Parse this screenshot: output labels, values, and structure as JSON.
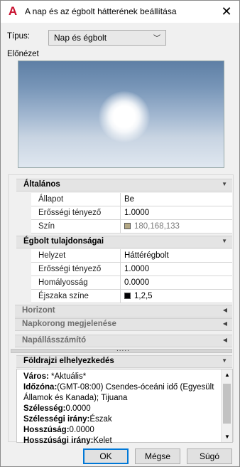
{
  "window": {
    "title": "A nap és az égbolt hátterének beállítása"
  },
  "type_label": "Típus:",
  "type_value": "Nap és égbolt",
  "preview_label": "Előnézet",
  "general": {
    "header": "Általános",
    "rows": [
      {
        "key": "Állapot",
        "value": "Be"
      },
      {
        "key": "Erősségi tényező",
        "value": "1.0000"
      },
      {
        "key": "Szín",
        "value": "180,168,133",
        "color": "#b4a885"
      }
    ]
  },
  "sky": {
    "header": "Égbolt tulajdonságai",
    "rows": [
      {
        "key": "Helyzet",
        "value": "Háttérégbolt"
      },
      {
        "key": "Erősségi tényező",
        "value": "1.0000"
      },
      {
        "key": "Homályosság",
        "value": "0.0000"
      },
      {
        "key": "Éjszaka színe",
        "value": "1,2,5",
        "color": "#010205"
      }
    ]
  },
  "collapsed": [
    "Horizont",
    "Napkorong megjelenése",
    "Napállásszámító"
  ],
  "splitter_dots": ".....",
  "geo": {
    "header": "Földrajzi elhelyezkedés",
    "lines": [
      {
        "label": "Város:",
        "value": " *Aktuális*"
      },
      {
        "label": "Időzóna:",
        "value": "(GMT-08:00) Csendes-óceáni idő (Egyesült Államok és Kanada); Tijuana"
      },
      {
        "label": "Szélesség:",
        "value": "0.0000"
      },
      {
        "label": "Szélességi irány:",
        "value": "Észak"
      },
      {
        "label": "Hosszúság:",
        "value": "0.0000"
      },
      {
        "label": "Hosszúsági irány:",
        "value": "Kelet"
      }
    ]
  },
  "buttons": {
    "ok": "OK",
    "cancel": "Mégse",
    "help": "Súgó"
  }
}
